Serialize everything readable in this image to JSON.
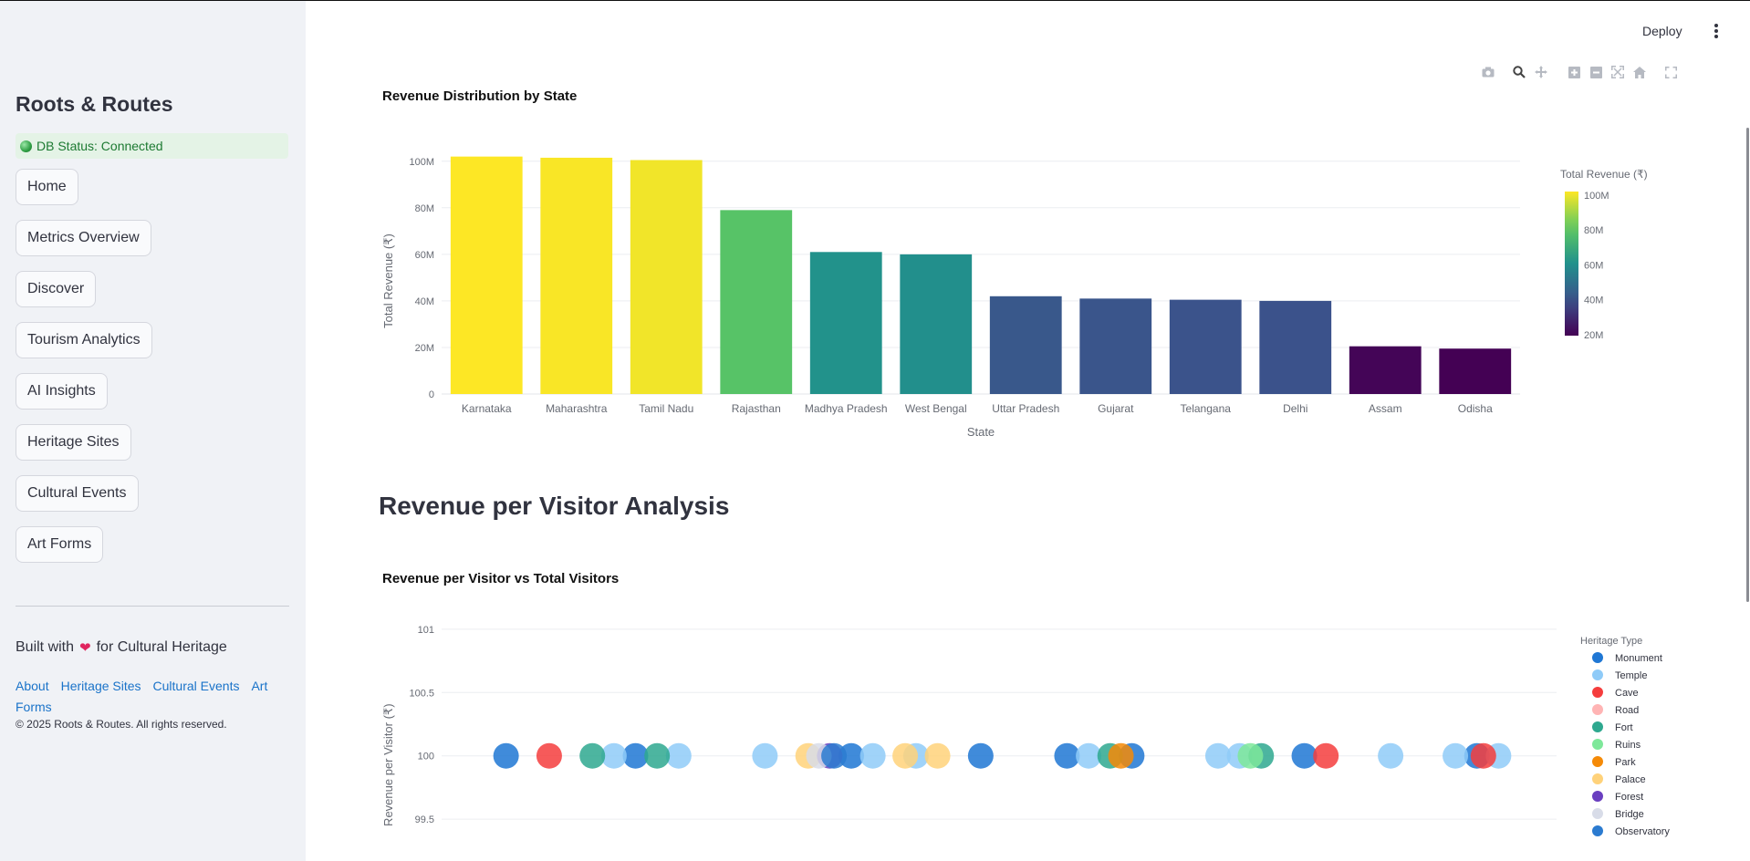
{
  "app": {
    "title": "Roots & Routes",
    "db_status": "DB Status: Connected"
  },
  "sidebar": {
    "nav": [
      {
        "label": "Home"
      },
      {
        "label": "Metrics Overview"
      },
      {
        "label": "Discover"
      },
      {
        "label": "Tourism Analytics"
      },
      {
        "label": "AI Insights"
      },
      {
        "label": "Heritage Sites"
      },
      {
        "label": "Cultural Events"
      },
      {
        "label": "Art Forms"
      }
    ],
    "built_prefix": "Built with",
    "built_suffix": "for Cultural Heritage",
    "footer_links": [
      "About",
      "Heritage Sites",
      "Cultural Events",
      "Art Forms"
    ],
    "copyright": "© 2025 Roots & Routes. All rights reserved."
  },
  "header": {
    "deploy_label": "Deploy"
  },
  "modebar": [
    "camera-icon",
    "zoom-icon",
    "pan-icon",
    "zoom-in-icon",
    "zoom-out-icon",
    "autoscale-icon",
    "reset-axes-icon",
    "fullscreen-icon"
  ],
  "main": {
    "section_title": "Revenue per Visitor Analysis"
  },
  "chart_data": [
    {
      "type": "bar",
      "title": "Revenue Distribution by State",
      "xlabel": "State",
      "ylabel": "Total Revenue (₹)",
      "categories": [
        "Karnataka",
        "Maharashtra",
        "Tamil Nadu",
        "Rajasthan",
        "Madhya Pradesh",
        "West Bengal",
        "Uttar Pradesh",
        "Gujarat",
        "Telangana",
        "Delhi",
        "Assam",
        "Odisha"
      ],
      "values": [
        102,
        101.5,
        100.5,
        79,
        61,
        60,
        42,
        41,
        40.5,
        40,
        20.5,
        19.5
      ],
      "value_unit": "M",
      "ylim": [
        0,
        105
      ],
      "yticks": [
        "0",
        "20M",
        "40M",
        "60M",
        "80M",
        "100M"
      ],
      "colorscale": "viridis",
      "colorbar": {
        "title": "Total Revenue (₹)",
        "ticks": [
          "20M",
          "40M",
          "60M",
          "80M",
          "100M"
        ],
        "range": [
          19.5,
          102
        ]
      },
      "grid": true
    },
    {
      "type": "scatter",
      "title": "Revenue per Visitor vs Total Visitors",
      "ylabel": "Revenue per Visitor (₹)",
      "ylim": [
        99.4,
        101.1
      ],
      "yticks": [
        "99.5",
        "100",
        "100.5",
        "101"
      ],
      "legend_title": "Heritage Type",
      "legend_position": "right",
      "series": [
        {
          "name": "Monument",
          "color": "#1f77d4",
          "x": [
            1,
            7,
            17,
            23,
            27,
            30,
            38,
            46
          ]
        },
        {
          "name": "Temple",
          "color": "#8fcbf8",
          "x": [
            6,
            9,
            13,
            18,
            20,
            28,
            34,
            35,
            42,
            45,
            47
          ]
        },
        {
          "name": "Cave",
          "color": "#f53d3d",
          "x": [
            3,
            39,
            46.3
          ]
        },
        {
          "name": "Road",
          "color": "#ffb4b4",
          "x": []
        },
        {
          "name": "Fort",
          "color": "#2ea88f",
          "x": [
            5,
            8,
            29,
            36
          ]
        },
        {
          "name": "Ruins",
          "color": "#7ee89a",
          "x": [
            35.5
          ]
        },
        {
          "name": "Park",
          "color": "#f58a07",
          "x": [
            29.5
          ]
        },
        {
          "name": "Palace",
          "color": "#ffd27a",
          "x": [
            15,
            19.5,
            21
          ]
        },
        {
          "name": "Forest",
          "color": "#6a3fc0",
          "x": [
            16
          ]
        },
        {
          "name": "Bridge",
          "color": "#d8dce8",
          "x": [
            15.5
          ]
        },
        {
          "name": "Observatory",
          "color": "#2b7bd0",
          "x": [
            16.2
          ]
        }
      ],
      "y_value": 100
    }
  ]
}
